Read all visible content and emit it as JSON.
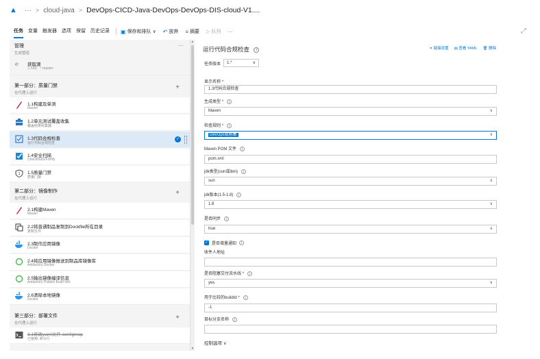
{
  "topbar": {
    "project": "cloud-java",
    "pipeline_title": "DevOps-CICD-Java-DevOps-DevOps-DIS-cloud-V1...."
  },
  "toolbar": {
    "tabs": [
      "任务",
      "变量",
      "触发器",
      "选项",
      "保留",
      "历史记录"
    ],
    "save_label": "保存和排队",
    "discard_label": "放弃",
    "summary_label": "摘要",
    "queue_label": "队列"
  },
  "left": {
    "manage": {
      "title": "管理",
      "subtitle": "生成管道"
    },
    "source": {
      "title": "获取源",
      "repo": "DIS",
      "branch": "master"
    },
    "phases": [
      {
        "title": "第一部分：质量门禁",
        "subtitle": "在代理上运行",
        "tasks": [
          {
            "name": "1.1构建及单测",
            "sub": "Maven"
          },
          {
            "name": "1.2单元测试覆盖收集",
            "sub": "覆盖结果收集器"
          },
          {
            "name": "1.3代码合规检查",
            "sub": "运行代码合规检查"
          },
          {
            "name": "1.4安全扫描",
            "sub": "Checkmarx/Fortify"
          },
          {
            "name": "1.5质量门禁",
            "sub": "质量门禁"
          }
        ]
      },
      {
        "title": "第二部分：镜像制作",
        "subtitle": "在代理上运行",
        "tasks": [
          {
            "name": "2.1构建Maven",
            "sub": "Maven"
          },
          {
            "name": "2.2将普通制品复制到Dockfile所在目录",
            "sub": "复制文件"
          },
          {
            "name": "2.3制作应用镜像",
            "sub": "Docker"
          },
          {
            "name": "2.4将应用镜像推送到制品库镜像库",
            "sub": "Artifactory Docker"
          },
          {
            "name": "2.5输出镜像编译信息",
            "sub": "Artifactory Publish Build Info"
          },
          {
            "name": "2.6清除本地镜像",
            "sub": "Docker"
          }
        ]
      },
      {
        "title": "第三部分：部署文件",
        "subtitle": "在代理上运行",
        "tasks": [
          {
            "name": "3.1修改yaml文件-configmap",
            "sub": "已禁用: 命令行"
          }
        ]
      }
    ]
  },
  "right": {
    "title": "运行代码合规检查",
    "links": [
      "链接设置",
      "查看 YAML",
      "删除"
    ],
    "version_label": "任务版本",
    "version_value": "1.*",
    "display_name_label": "显示名称",
    "display_name_value": "1.3代码合规检查",
    "gen_type_label": "生成类型",
    "gen_type_value": "Maven",
    "check_rule_label": "检查规则",
    "check_rule_value": "DevOps规则集",
    "pom_label": "Maven POM 文件",
    "pom_value": "pom.xml",
    "jdk_type_label": "jdk类型(sun或ibm)",
    "jdk_type_value": "sun",
    "jdk_version_label": "jdk版本(1.5-1.8)",
    "jdk_version_value": "1.8",
    "async_label": "是否同步",
    "async_value": "true",
    "incremental_label": "是否增量通知",
    "recipient_label": "收件人地址",
    "recipient_value": "",
    "fail_build_label": "是否阻塞交付流水线",
    "fail_build_value": "yes",
    "buildid_label": "用于比较的buildId",
    "buildid_value": "-1",
    "target_branch_label": "目标分支名称",
    "target_branch_value": "",
    "control_options_label": "控制选项"
  }
}
